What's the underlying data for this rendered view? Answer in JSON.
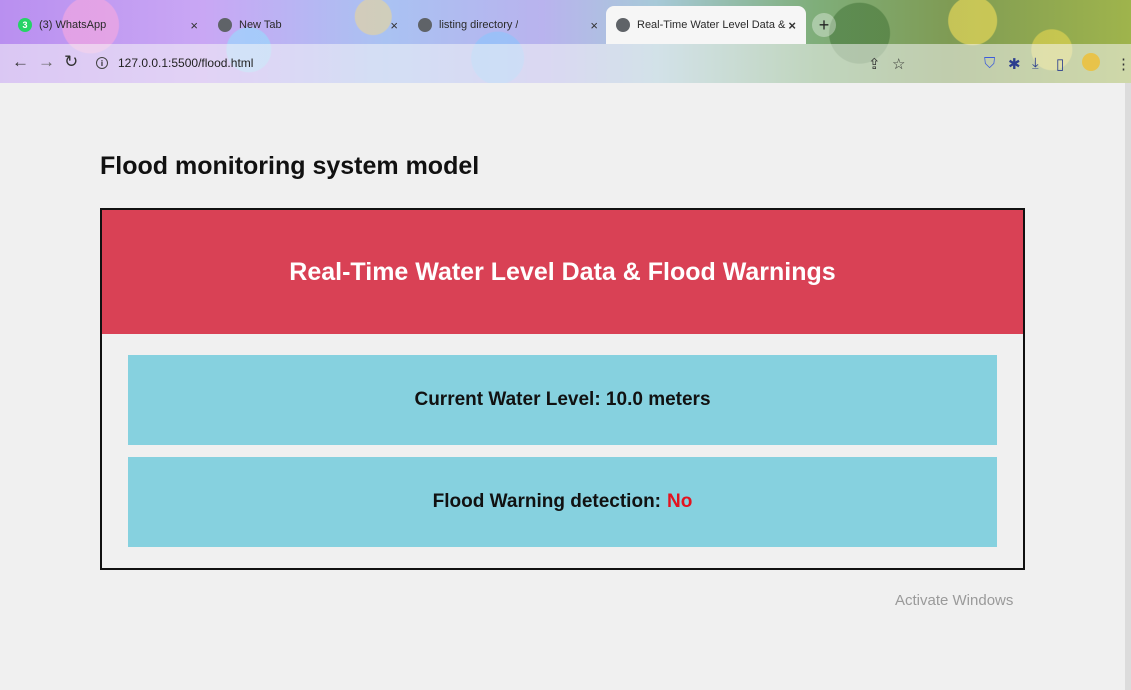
{
  "browser": {
    "tabs": [
      {
        "title": "(3) WhatsApp",
        "close": "×"
      },
      {
        "title": "New Tab",
        "close": "×"
      },
      {
        "title": "listing directory /",
        "close": "×"
      },
      {
        "title": "Real-Time Water Level Data & F",
        "close": "×"
      }
    ],
    "new_tab": "+",
    "url": "127.0.0.1:5500/flood.html",
    "info": "i"
  },
  "page": {
    "title": "Flood monitoring system model",
    "card": {
      "header": "Real-Time Water Level Data & Flood Warnings",
      "water_level": "Current Water Level: 10.0 meters",
      "warning_label": "Flood Warning detection:",
      "warning_value": "No"
    },
    "watermark": "Activate Windows"
  },
  "colors": {
    "header_bg": "#d94155",
    "box_bg": "#86d1df",
    "warning_value": "#e4121f"
  },
  "icons": [
    "whatsapp-icon",
    "chrome-icon",
    "globe-icon",
    "back-icon",
    "forward-icon",
    "reload-icon",
    "info-icon",
    "share-icon",
    "star-icon",
    "shield-icon",
    "extensions-icon",
    "download-icon",
    "sidebar-icon",
    "profile-icon",
    "menu-icon"
  ]
}
